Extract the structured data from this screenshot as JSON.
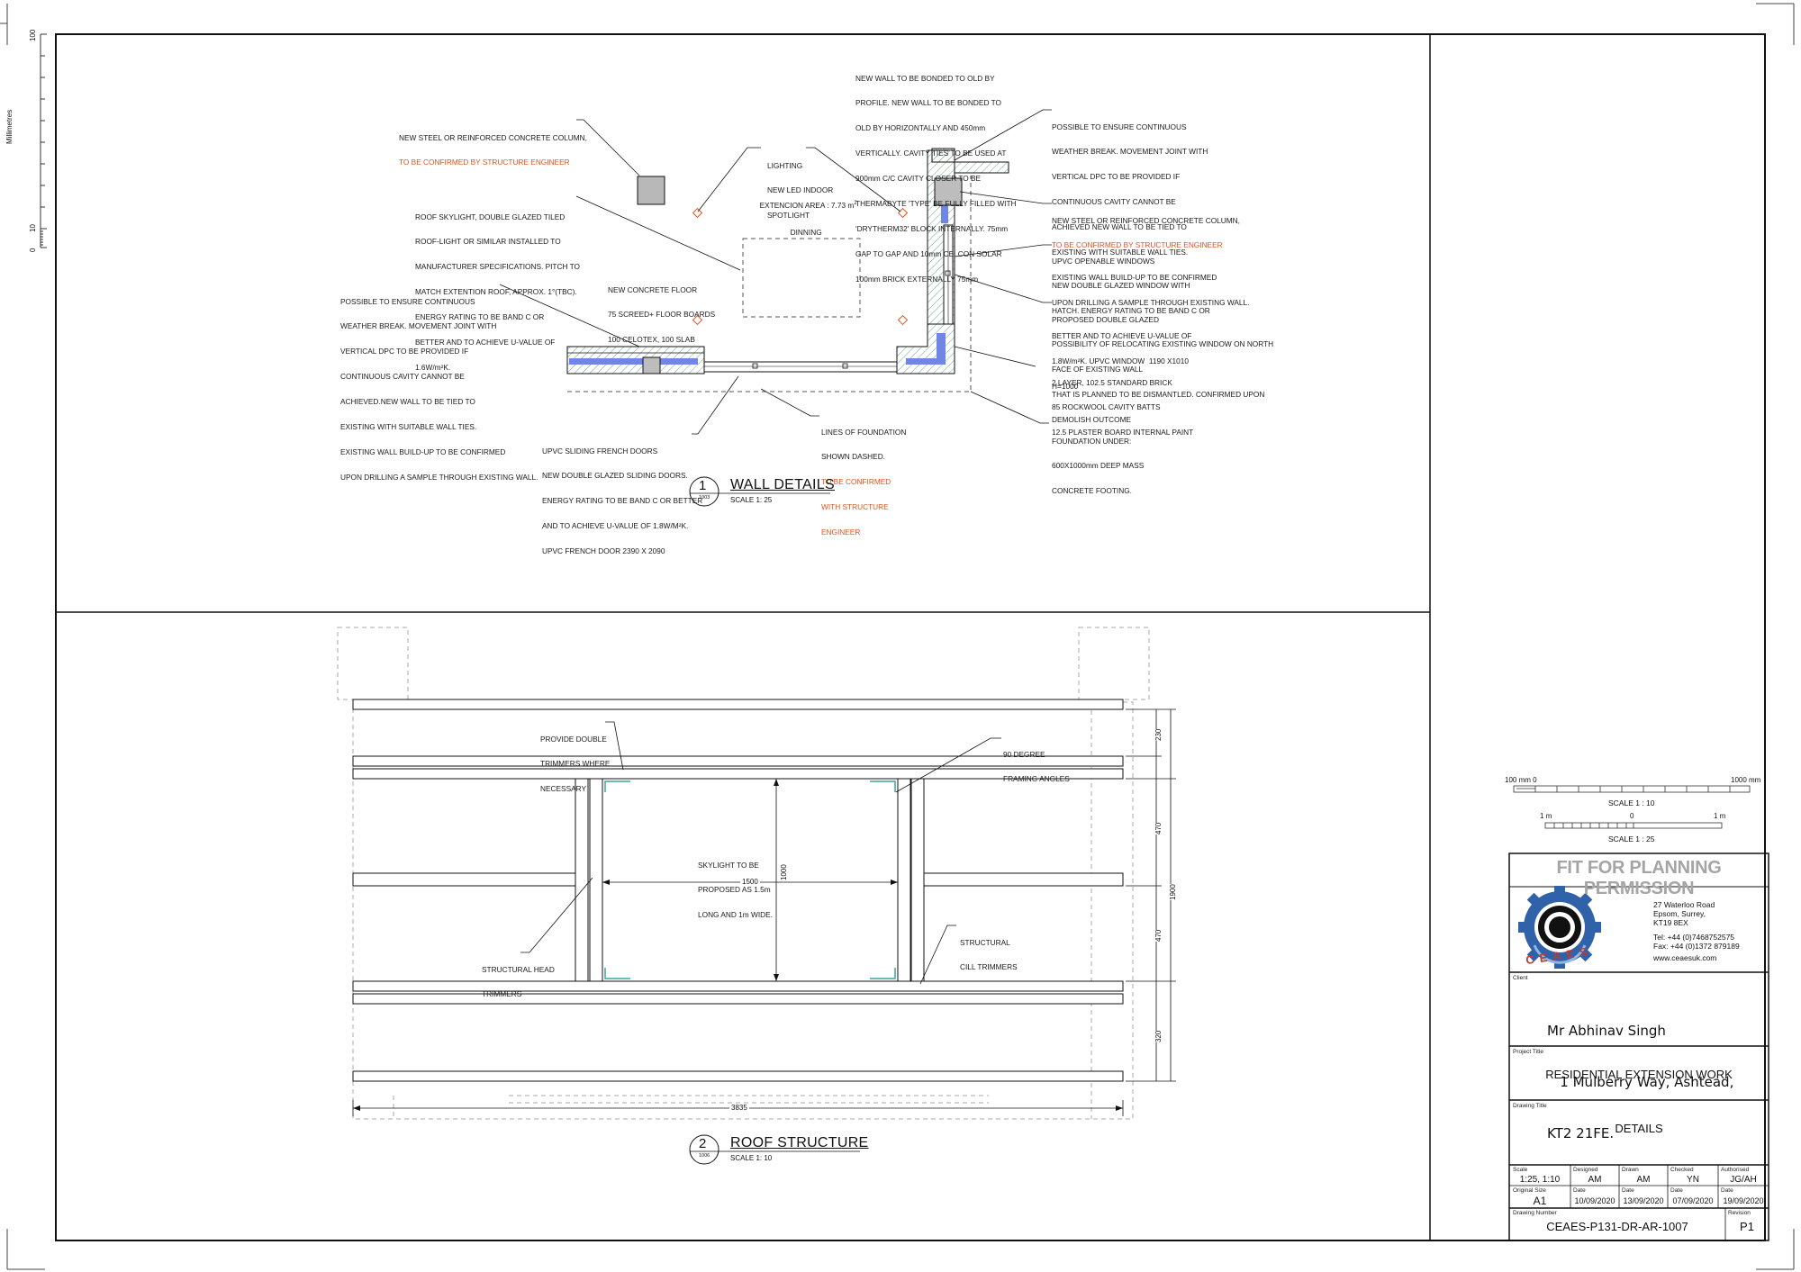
{
  "ruler": {
    "unit_label": "Millimetres",
    "ticks": [
      "100",
      "10",
      "0"
    ]
  },
  "wall_details": {
    "number": "1",
    "ref": "1003",
    "title": "WALL DETAILS",
    "scale": "SCALE 1: 25",
    "labels": {
      "area_prefix": "EXTENCION AREA : 7.73 m",
      "area_sup": "2",
      "room": "DINNING"
    },
    "notes": {
      "column_left": [
        "NEW STEEL OR REINFORCED CONCRETE COLUMN,"
      ],
      "column_left_red": [
        "TO BE CONFIRMED BY STRUCTURE ENGINEER"
      ],
      "skylight": [
        "ROOF SKYLIGHT, DOUBLE GLAZED TILED",
        "ROOF-LIGHT OR SIMILAR INSTALLED TO",
        "MANUFACTURER SPECIFICATIONS. PITCH TO",
        "MATCH EXTENTION ROOF, APPROX. 1°(TBC).",
        "ENERGY RATING TO BE BAND C OR",
        "BETTER AND TO ACHIEVE U-VALUE OF",
        "1.6W/m²K."
      ],
      "weather_left": [
        "POSSIBLE TO ENSURE CONTINUOUS",
        "WEATHER BREAK. MOVEMENT JOINT WITH",
        "VERTICAL DPC TO BE PROVIDED IF",
        "CONTINUOUS CAVITY CANNOT BE",
        "ACHIEVED.NEW WALL TO BE TIED TO",
        "EXISTING WITH SUITABLE WALL TIES.",
        "EXISTING WALL BUILD-UP TO BE CONFIRMED",
        "UPON DRILLING A SAMPLE THROUGH EXISTING WALL."
      ],
      "lighting": [
        "LIGHTING",
        "NEW LED INDOOR",
        "SPOTLIGHT"
      ],
      "floor": [
        "NEW CONCRETE FLOOR",
        "75 SCREED+ FLOOR BOARDS",
        "100 CELOTEX, 100 SLAB"
      ],
      "new_wall": [
        "NEW WALL TO BE BONDED TO OLD BY",
        "PROFILE. NEW WALL TO BE BONDED TO",
        "OLD BY HORIZONTALLY AND 450mm",
        "VERTICALLY. CAVITY TIES TO BE USED AT",
        "900mm C/C CAVITY CLOSER TO BE",
        "THERMABYTE 'TYPE' BE FULLY FILLED WITH",
        "'DRYTHERM32' BLOCK INTERNALLY. 75mm",
        "GAP TO GAP AND 10mm CELCON SOLAR",
        "100mm BRICK EXTERNALLY 75mm"
      ],
      "weather_right": [
        "POSSIBLE TO ENSURE CONTINUOUS",
        "WEATHER BREAK. MOVEMENT JOINT WITH",
        "VERTICAL DPC TO BE PROVIDED IF",
        "CONTINUOUS CAVITY CANNOT BE",
        "ACHIEVED NEW WALL TO BE TIED TO",
        "EXISTING WITH SUITABLE WALL TIES.",
        "EXISTING WALL BUILD-UP TO BE CONFIRMED",
        "UPON DRILLING A SAMPLE THROUGH EXISTING WALL."
      ],
      "column_right": [
        "NEW STEEL OR REINFORCED CONCRETE COLUMN,"
      ],
      "column_right_red": [
        "TO BE CONFIRMED BY STRUCTURE ENGINEER"
      ],
      "upvc_windows": [
        "UPVC OPENABLE WINDOWS",
        "NEW DOUBLE GLAZED WINDOW WITH",
        "HATCH. ENERGY RATING TO BE BAND C OR",
        "BETTER AND TO ACHIEVE U-VALUE OF",
        "1.8W/m²K. UPVC WINDOW  1190 X1010",
        "H=1000"
      ],
      "double_glazed": [
        "PROPOSED DOUBLE GLAZED",
        "POSSIBILITY OF RELOCATING EXISTING WINDOW ON NORTH",
        "FACE OF EXISTING WALL",
        "THAT IS PLANNED TO BE DISMANTLED. CONFIRMED UPON",
        "DEMOLISH OUTCOME"
      ],
      "brick": [
        "2 LAYER, 102.5 STANDARD BRICK",
        "85 ROCKWOOL CAVITY BATTS",
        "12.5 PLASTER BOARD INTERNAL PAINT"
      ],
      "foundation_lines": [
        "LINES OF FOUNDATION",
        "SHOWN DASHED."
      ],
      "foundation_lines_red": [
        "TO BE CONFIRMED",
        "WITH STRUCTURE",
        "ENGINEER"
      ],
      "foundation_under": [
        "FOUNDATION UNDER:",
        "600X1000mm DEEP MASS",
        "CONCRETE FOOTING."
      ],
      "french_doors": [
        "UPVC SLIDING FRENCH DOORS",
        "NEW DOUBLE GLAZED SLIDING DOORS.",
        "ENERGY RATING TO BE BAND C OR BETTER",
        "AND TO ACHIEVE U-VALUE OF 1.8W/M²K.",
        "UPVC FRENCH DOOR 2390 X 2090"
      ]
    }
  },
  "roof_structure": {
    "number": "2",
    "ref": "1006",
    "title": "ROOF STRUCTURE",
    "scale": "SCALE 1: 10",
    "notes": {
      "trimmers": [
        "PROVIDE DOUBLE",
        "TRIMMERS WHERE",
        "NECESSARY"
      ],
      "framing": [
        "90 DEGREE",
        "FRAMING ANGLES"
      ],
      "skylight": [
        "SKYLIGHT TO BE",
        "PROPOSED AS 1.5m",
        "LONG AND 1m WIDE."
      ],
      "head_trimmers": [
        "STRUCTURAL HEAD",
        "TRIMMERS"
      ],
      "cill_trimmers": [
        "STRUCTURAL",
        "CILL TRIMMERS"
      ]
    },
    "dimensions": {
      "d1500": "1500",
      "d1000": "1000",
      "d3835": "3835",
      "d1900": "1900",
      "d230": "230",
      "d470a": "470",
      "d470b": "470",
      "d320": "320"
    }
  },
  "scale_bars": {
    "top_left": "100 mm  0",
    "top_right": "1000 mm",
    "top_caption": "SCALE 1 : 10",
    "bottom_left": "1 m",
    "bottom_mid": "0",
    "bottom_right": "1 m",
    "bottom_caption": "SCALE 1 : 25"
  },
  "title_block": {
    "banner": "FIT FOR PLANNING PERMISSION",
    "logo_text": "CEAES",
    "address": [
      "27 Waterloo Road",
      "Epsom, Surrey,",
      "KT19 8EX"
    ],
    "tel": "Tel: +44 (0)7468752575",
    "fax": "Fax: +44 (0)1372 879189",
    "web": "www.ceaesuk.com",
    "client_label": "Client",
    "client": [
      "Mr Abhinav Singh",
      "   1 Mulberry Way, Ashtead,",
      "KT2 21FE."
    ],
    "project_label": "Project Title",
    "project": "RESIDENTIAL EXTENSION WORK",
    "drawing_label": "Drawing Title",
    "drawing": "DETAILS",
    "fields": {
      "scale_label": "Scale",
      "scale": "1:25, 1:10",
      "designed_label": "Designed",
      "designed": "AM",
      "drawn_label": "Drawn",
      "drawn": "AM",
      "checked_label": "Checked",
      "checked": "YN",
      "authorised_label": "Authorised",
      "authorised": "JG/AH",
      "size_label": "Original Size",
      "size": "A1",
      "date1_label": "Date",
      "date1": "10/09/2020",
      "date2_label": "Date",
      "date2": "13/09/2020",
      "date3_label": "Date",
      "date3": "07/09/2020",
      "date4_label": "Date",
      "date4": "19/09/2020",
      "number_label": "Drawing Number",
      "number": "CEAES-P131-DR-AR-1007",
      "revision_label": "Revision",
      "revision": "P1"
    }
  },
  "colors": {
    "line": "#111111",
    "insulation": "#6f86e6",
    "hatch": "#6fa88c",
    "red": "#e2531d",
    "banner": "#a5a5a5",
    "logo_blue": "#2f62a8",
    "logo_red": "#c23a2a"
  }
}
